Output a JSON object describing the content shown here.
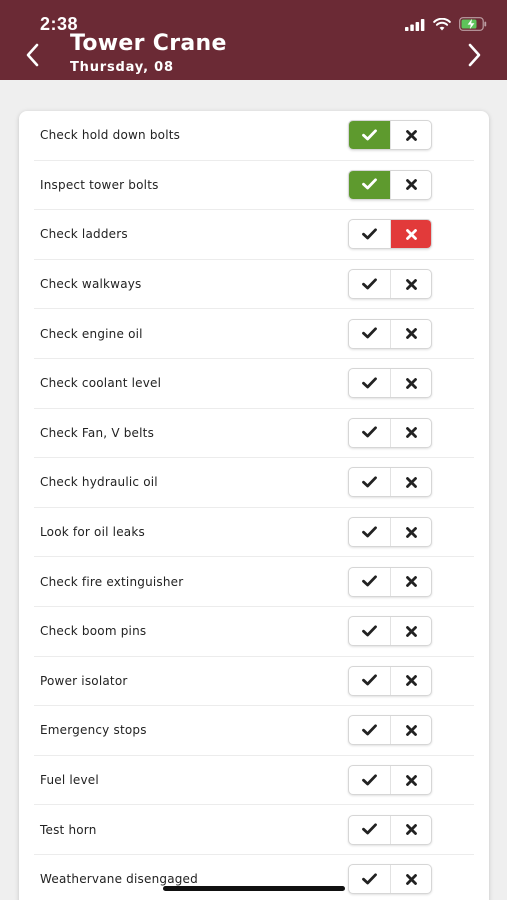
{
  "status_bar": {
    "time": "2:38"
  },
  "header": {
    "title": "Tower Crane",
    "subtitle": "Thursday,  08",
    "background": "#6b2a35"
  },
  "colors": {
    "pass": "#5e9a2e",
    "fail": "#e23a3a"
  },
  "icons": {
    "pass": "check-icon",
    "fail": "x-icon"
  },
  "checklist": [
    {
      "label": "Check hold down bolts",
      "state": "pass"
    },
    {
      "label": "Inspect tower bolts",
      "state": "pass"
    },
    {
      "label": "Check ladders",
      "state": "fail"
    },
    {
      "label": "Check walkways",
      "state": "none"
    },
    {
      "label": "Check engine oil",
      "state": "none"
    },
    {
      "label": "Check coolant level",
      "state": "none"
    },
    {
      "label": "Check Fan, V belts",
      "state": "none"
    },
    {
      "label": "Check hydraulic oil",
      "state": "none"
    },
    {
      "label": "Look for oil leaks",
      "state": "none"
    },
    {
      "label": "Check fire extinguisher",
      "state": "none"
    },
    {
      "label": "Check boom pins",
      "state": "none"
    },
    {
      "label": "Power isolator",
      "state": "none"
    },
    {
      "label": "Emergency stops",
      "state": "none"
    },
    {
      "label": "Fuel level",
      "state": "none"
    },
    {
      "label": "Test horn",
      "state": "none"
    },
    {
      "label": "Weathervane disengaged",
      "state": "none"
    }
  ]
}
